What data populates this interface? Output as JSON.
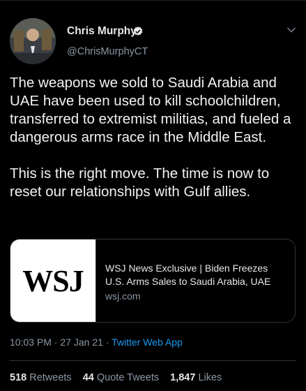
{
  "author": {
    "name": "Chris Murphy",
    "handle": "@ChrisMurphyCT",
    "verified": true,
    "avatar_icon": "profile-photo"
  },
  "tweet": {
    "paragraphs": [
      "The weapons we sold to Saudi Arabia and UAE have been used to kill schoolchildren, transferred to extremist militias, and fueled a dangerous arms race in the Middle East.",
      "This is the right move. The time is now to reset our relationships with Gulf allies."
    ]
  },
  "card": {
    "logo_text": "WSJ",
    "title": "WSJ News Exclusive | Biden Freezes U.S. Arms Sales to Saudi Arabia, UAE",
    "domain": "wsj.com"
  },
  "meta": {
    "time": "10:03 PM",
    "date": "27 Jan 21",
    "separator": "·",
    "source": "Twitter Web App"
  },
  "stats": {
    "retweets_count": "518",
    "retweets_label": "Retweets",
    "quotes_count": "44",
    "quotes_label": "Quote Tweets",
    "likes_count": "1,847",
    "likes_label": "Likes"
  },
  "colors": {
    "background": "#000000",
    "link": "#1d9bf0",
    "muted": "#8b98a5",
    "verified": "#e7e9ea"
  }
}
